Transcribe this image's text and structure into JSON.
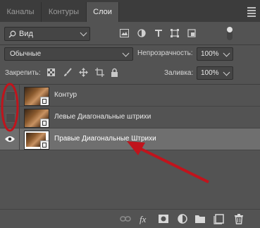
{
  "tabs": [
    {
      "label": "Каналы",
      "active": false
    },
    {
      "label": "Контуры",
      "active": false
    },
    {
      "label": "Слои",
      "active": true
    }
  ],
  "filter": {
    "label": "Вид"
  },
  "blend": {
    "mode": "Обычные",
    "opacity_label": "Непрозрачность:",
    "opacity_value": "100%"
  },
  "lock": {
    "label": "Закрепить:",
    "fill_label": "Заливка:",
    "fill_value": "100%"
  },
  "layers": [
    {
      "name": "Контур",
      "visible": false,
      "selected": false
    },
    {
      "name": "Левые Диагональные штрихи",
      "visible": false,
      "selected": false
    },
    {
      "name": "Правые Диагональные Штрихи",
      "visible": true,
      "selected": true
    }
  ],
  "annotation_colors": {
    "circle": "#c0141c",
    "arrow": "#c0141c"
  },
  "icons": [
    "link-icon",
    "fx-icon",
    "mask-icon",
    "adjustment-icon",
    "folder-icon",
    "new-layer-icon",
    "trash-icon"
  ]
}
